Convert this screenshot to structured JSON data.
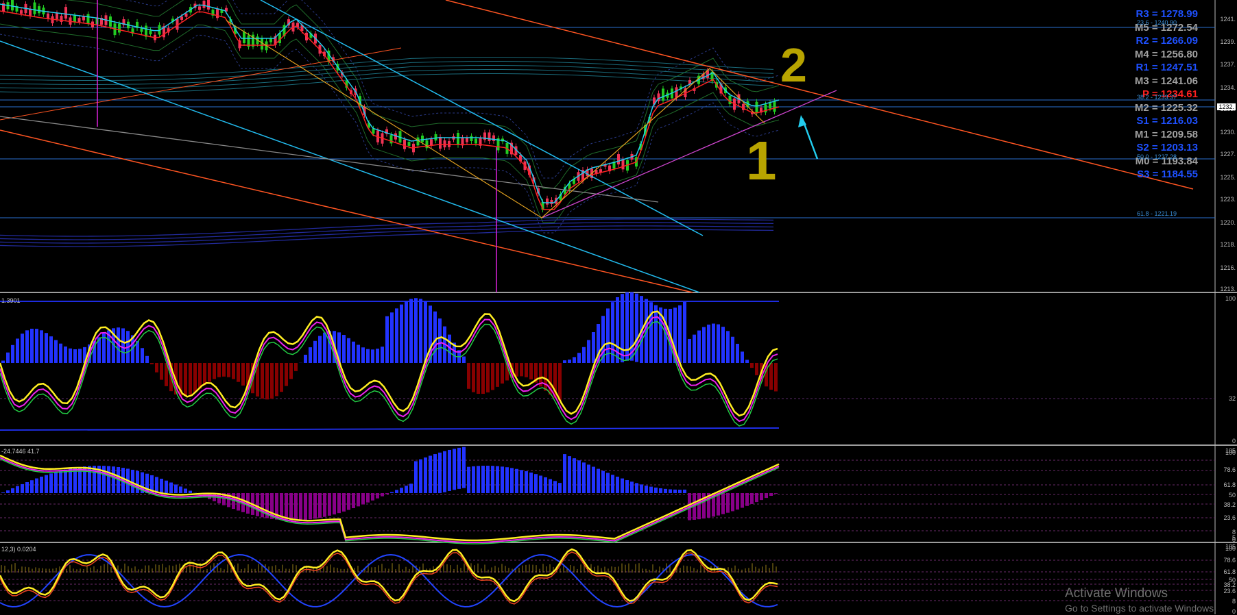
{
  "axis_price": [
    "1241.",
    "1239.",
    "1237.",
    "1234.",
    "1232.",
    "1230.",
    "1227.",
    "1225.",
    "1223.",
    "1220.",
    "1218.",
    "1216.",
    "1213."
  ],
  "axis_osc1": [
    "100",
    "32",
    "0"
  ],
  "axis_osc2": [
    "105",
    "100",
    "78.6",
    "61.8",
    "50",
    "38.2",
    "23.6",
    "8",
    "5",
    "0"
  ],
  "axis_osc3": [
    "105",
    "100",
    "78.6",
    "61.8",
    "50",
    "38.2",
    "23.6",
    "8",
    "0"
  ],
  "current_price": "1232.",
  "pivots": [
    {
      "label": "R3 = 1278.99",
      "color": "#1e50ff"
    },
    {
      "label": "M5 = 1272.54",
      "color": "#a0a0a0"
    },
    {
      "label": "R2 = 1266.09",
      "color": "#1e50ff"
    },
    {
      "label": "M4 = 1256.80",
      "color": "#a0a0a0"
    },
    {
      "label": "R1 = 1247.51",
      "color": "#1e50ff"
    },
    {
      "label": "M3 = 1241.06",
      "color": "#a0a0a0"
    },
    {
      "label": "P = 1234.61",
      "color": "#ff2020"
    },
    {
      "label": "M2 = 1225.32",
      "color": "#a0a0a0"
    },
    {
      "label": "S1 = 1216.03",
      "color": "#1e50ff"
    },
    {
      "label": "M1 = 1209.58",
      "color": "#a0a0a0"
    },
    {
      "label": "S2 = 1203.13",
      "color": "#1e50ff"
    },
    {
      "label": "M0 = 1193.84",
      "color": "#a0a0a0"
    },
    {
      "label": "S3 = 1184.55",
      "color": "#1e50ff"
    }
  ],
  "fib_levels": [
    {
      "label": "23.6 - 1240.90"
    },
    {
      "label": "38.2 - 1233.37"
    },
    {
      "label": "50.0 - 1227.28"
    },
    {
      "label": "61.8 - 1221.19"
    }
  ],
  "pane_labels": {
    "osc1": "1.3901",
    "osc2": "-24.7446 41.7",
    "osc3": "12,3) 0.0204"
  },
  "annotations": {
    "label1": "1",
    "label2": "2"
  },
  "watermark": {
    "title": "Activate Windows",
    "subtitle": "Go to Settings to activate Windows."
  },
  "colors": {
    "background": "#000000",
    "bull": "#22cc22",
    "bear": "#ee3355",
    "hist_up": "#2233ff",
    "hist_down": "#880000",
    "hist_down2": "#880088",
    "signal": "#ffee22",
    "channel": "#22bbee",
    "trend": "#ff5522"
  }
}
